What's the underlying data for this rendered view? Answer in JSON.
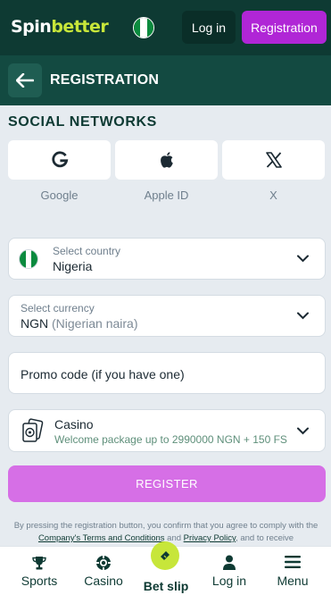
{
  "header": {
    "logo_spin": "Spin",
    "logo_better": "better",
    "login_label": "Log in",
    "registration_label": "Registration"
  },
  "page": {
    "title": "REGISTRATION"
  },
  "social": {
    "title": "SOCIAL NETWORKS",
    "items": [
      {
        "label": "Google",
        "icon": "google-icon"
      },
      {
        "label": "Apple ID",
        "icon": "apple-icon"
      },
      {
        "label": "X",
        "icon": "x-icon"
      }
    ]
  },
  "form": {
    "country_label": "Select country",
    "country_value": "Nigeria",
    "currency_label": "Select currency",
    "currency_code": "NGN",
    "currency_name": "(Nigerian naira)",
    "promo_placeholder": "Promo code (if you have one)",
    "bonus_title": "Casino",
    "bonus_desc": "Welcome package up to 2990000 NGN + 150 FS",
    "register_label": "REGISTER"
  },
  "terms": {
    "line_start": "By pressing the registration button, you confirm that you agree to comply with the ",
    "link_terms": "Company's Terms and Conditions",
    "and": " and ",
    "link_privacy": "Privacy Policy",
    "line_end": ", and to receive"
  },
  "nav": {
    "sports": "Sports",
    "casino": "Casino",
    "betslip": "Bet slip",
    "login": "Log in",
    "menu": "Menu"
  },
  "colors": {
    "header_bg": "#0e3a33",
    "accent_purple": "#b026d6",
    "accent_lime": "#c7e63a"
  }
}
